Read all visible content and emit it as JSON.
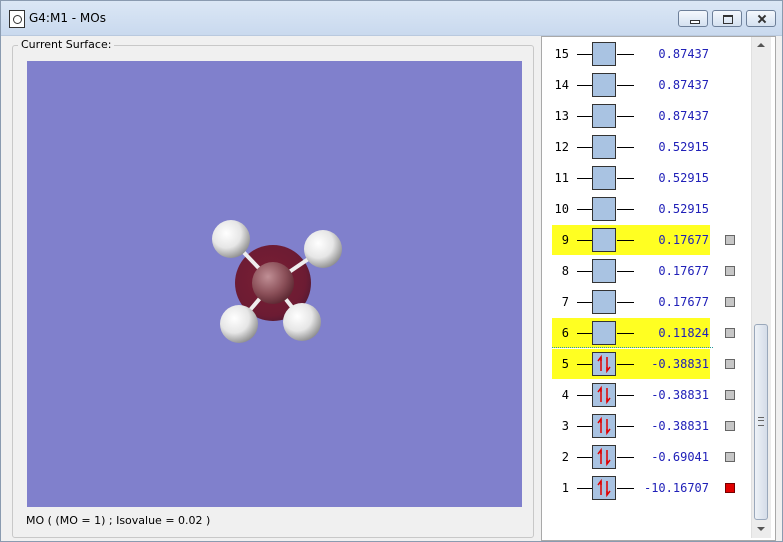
{
  "window": {
    "title": "G4:M1 - MOs",
    "icons": {
      "app": "document-icon",
      "minimize": "minimize-icon",
      "maximize": "maximize-icon",
      "close": "close-icon"
    }
  },
  "surface": {
    "label": "Current Surface:",
    "status": "MO ( (MO = 1) ; Isovalue = 0.02 )",
    "background_color": "#8080cc"
  },
  "orbitals": [
    {
      "number": "15",
      "energy": "0.87437",
      "occupied": false,
      "highlighted": false,
      "checkbox": "none"
    },
    {
      "number": "14",
      "energy": "0.87437",
      "occupied": false,
      "highlighted": false,
      "checkbox": "none"
    },
    {
      "number": "13",
      "energy": "0.87437",
      "occupied": false,
      "highlighted": false,
      "checkbox": "none"
    },
    {
      "number": "12",
      "energy": "0.52915",
      "occupied": false,
      "highlighted": false,
      "checkbox": "none"
    },
    {
      "number": "11",
      "energy": "0.52915",
      "occupied": false,
      "highlighted": false,
      "checkbox": "none"
    },
    {
      "number": "10",
      "energy": "0.52915",
      "occupied": false,
      "highlighted": false,
      "checkbox": "none"
    },
    {
      "number": "9",
      "energy": "0.17677",
      "occupied": false,
      "highlighted": true,
      "checkbox": "unchecked"
    },
    {
      "number": "8",
      "energy": "0.17677",
      "occupied": false,
      "highlighted": false,
      "checkbox": "unchecked"
    },
    {
      "number": "7",
      "energy": "0.17677",
      "occupied": false,
      "highlighted": false,
      "checkbox": "unchecked"
    },
    {
      "number": "6",
      "energy": "0.11824",
      "occupied": false,
      "highlighted": true,
      "checkbox": "unchecked"
    },
    {
      "number": "5",
      "energy": "-0.38831",
      "occupied": true,
      "highlighted": true,
      "checkbox": "unchecked"
    },
    {
      "number": "4",
      "energy": "-0.38831",
      "occupied": true,
      "highlighted": false,
      "checkbox": "unchecked"
    },
    {
      "number": "3",
      "energy": "-0.38831",
      "occupied": true,
      "highlighted": false,
      "checkbox": "unchecked"
    },
    {
      "number": "2",
      "energy": "-0.69041",
      "occupied": true,
      "highlighted": false,
      "checkbox": "unchecked"
    },
    {
      "number": "1",
      "energy": "-10.16707",
      "occupied": true,
      "highlighted": false,
      "checkbox": "checked"
    }
  ],
  "colors": {
    "highlight": "#ffff22",
    "energy_text": "#2020b8",
    "orbital_box": "#a9c3e2",
    "electron_arrows": "#e00000",
    "selected_checkbox": "#e00000"
  }
}
